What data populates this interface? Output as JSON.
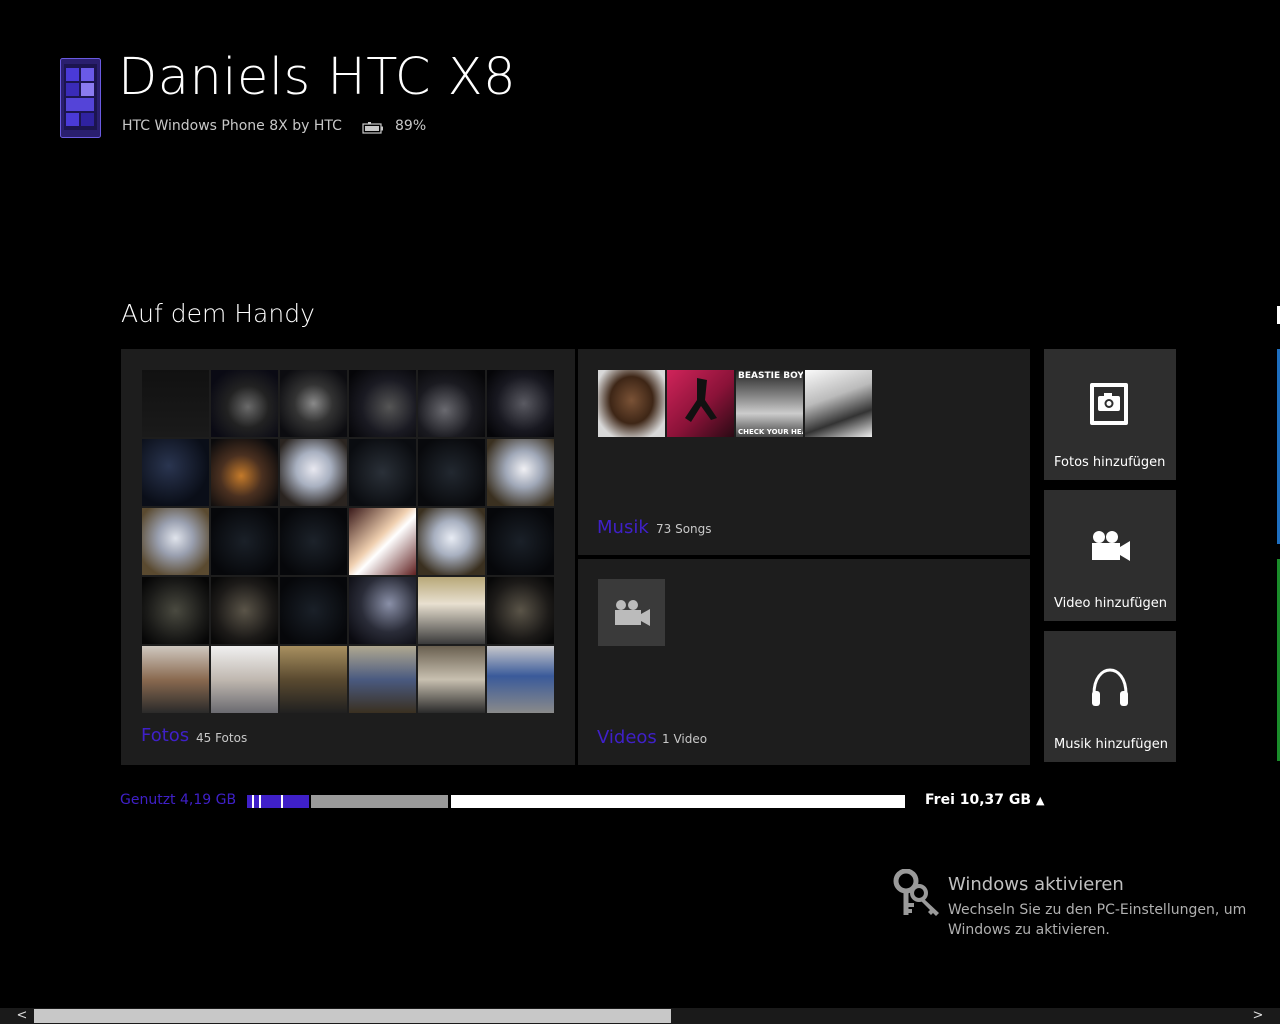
{
  "device": {
    "name": "Daniels HTC X8",
    "model": "HTC Windows Phone 8X by HTC",
    "battery": "89%"
  },
  "section_title": "Auf dem Handy",
  "photos": {
    "label": "Fotos",
    "count": "45 Fotos"
  },
  "music": {
    "label": "Musik",
    "count": "73 Songs",
    "album_captions": [
      "BEASTIE BOYS",
      "CHECK YOUR HEAD"
    ]
  },
  "videos": {
    "label": "Videos",
    "count": "1 Video"
  },
  "actions": {
    "add_photos": "Fotos hinzufügen",
    "add_video": "Video hinzufügen",
    "add_music": "Musik hinzufügen"
  },
  "storage": {
    "used": "Genutzt 4,19 GB",
    "free": "Frei 10,37 GB"
  },
  "activation": {
    "title": "Windows aktivieren",
    "subtitle": "Wechseln Sie zu den PC-Einstellungen, um Windows zu aktivieren."
  },
  "colors": {
    "accent": "#3f20c8",
    "tile": "#1d1d1d",
    "action_tile": "#2e2e2e",
    "background": "#000000"
  }
}
